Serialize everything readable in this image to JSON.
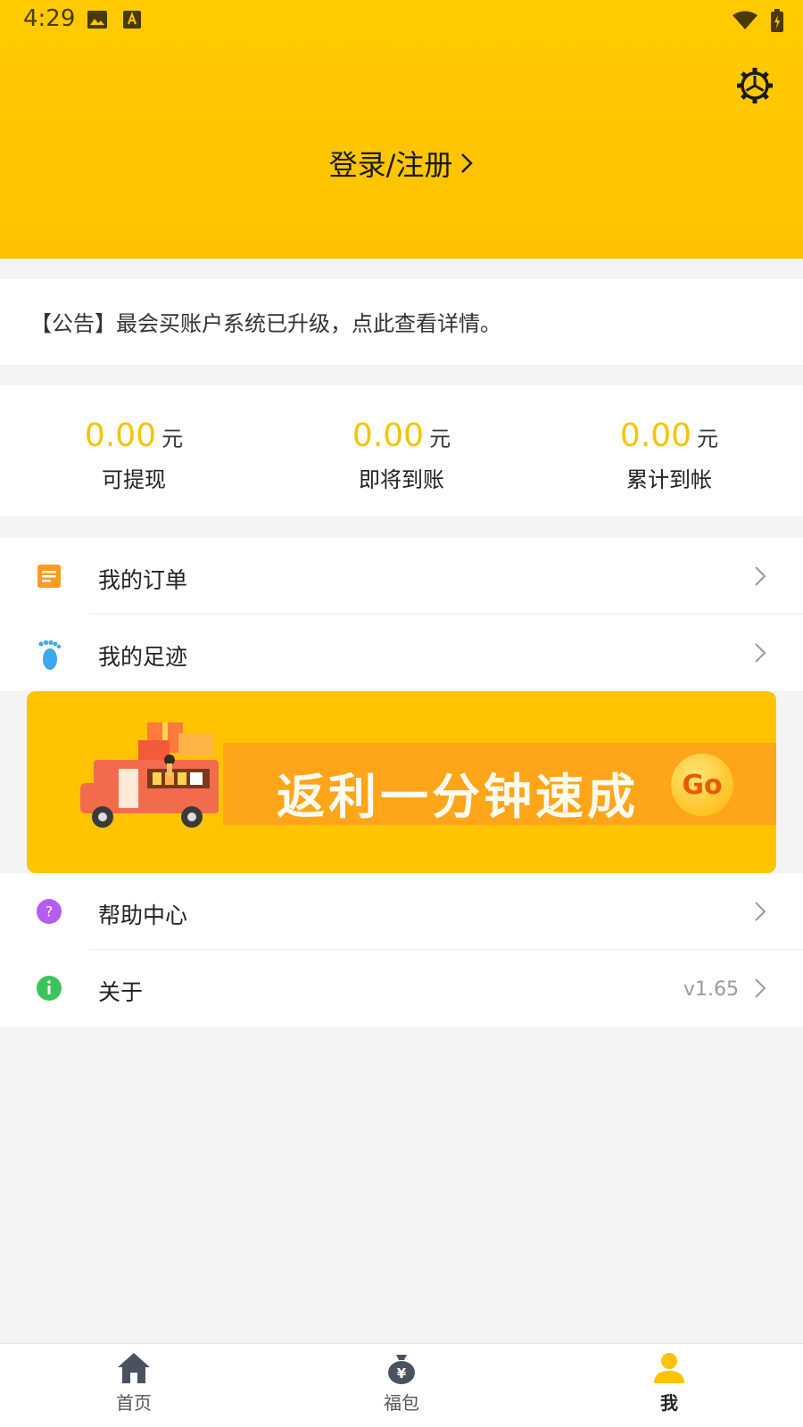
{
  "status_bar": {
    "time": "4:29"
  },
  "header": {
    "login_label": "登录/注册"
  },
  "notice": {
    "text": "【公告】最会买账户系统已升级，点此查看详情。"
  },
  "stats": [
    {
      "value": "0.00",
      "unit": "元",
      "label": "可提现"
    },
    {
      "value": "0.00",
      "unit": "元",
      "label": "即将到账"
    },
    {
      "value": "0.00",
      "unit": "元",
      "label": "累计到帐"
    }
  ],
  "menu_top": [
    {
      "label": "我的订单",
      "icon": "order-list-icon"
    },
    {
      "label": "我的足迹",
      "icon": "footprint-icon"
    }
  ],
  "banner": {
    "text": "返利一分钟速成",
    "go_label": "Go"
  },
  "menu_bottom": [
    {
      "label": "帮助中心",
      "icon": "help-icon",
      "extra": ""
    },
    {
      "label": "关于",
      "icon": "info-icon",
      "extra": "v1.65"
    }
  ],
  "bottom_nav": [
    {
      "label": "首页",
      "icon": "home-icon",
      "active": false
    },
    {
      "label": "福包",
      "icon": "money-bag-icon",
      "active": false
    },
    {
      "label": "我",
      "icon": "user-icon",
      "active": true
    }
  ],
  "colors": {
    "brand_yellow": "#ffc300",
    "accent_number": "#f5c400",
    "active_nav": "#ffc300"
  }
}
